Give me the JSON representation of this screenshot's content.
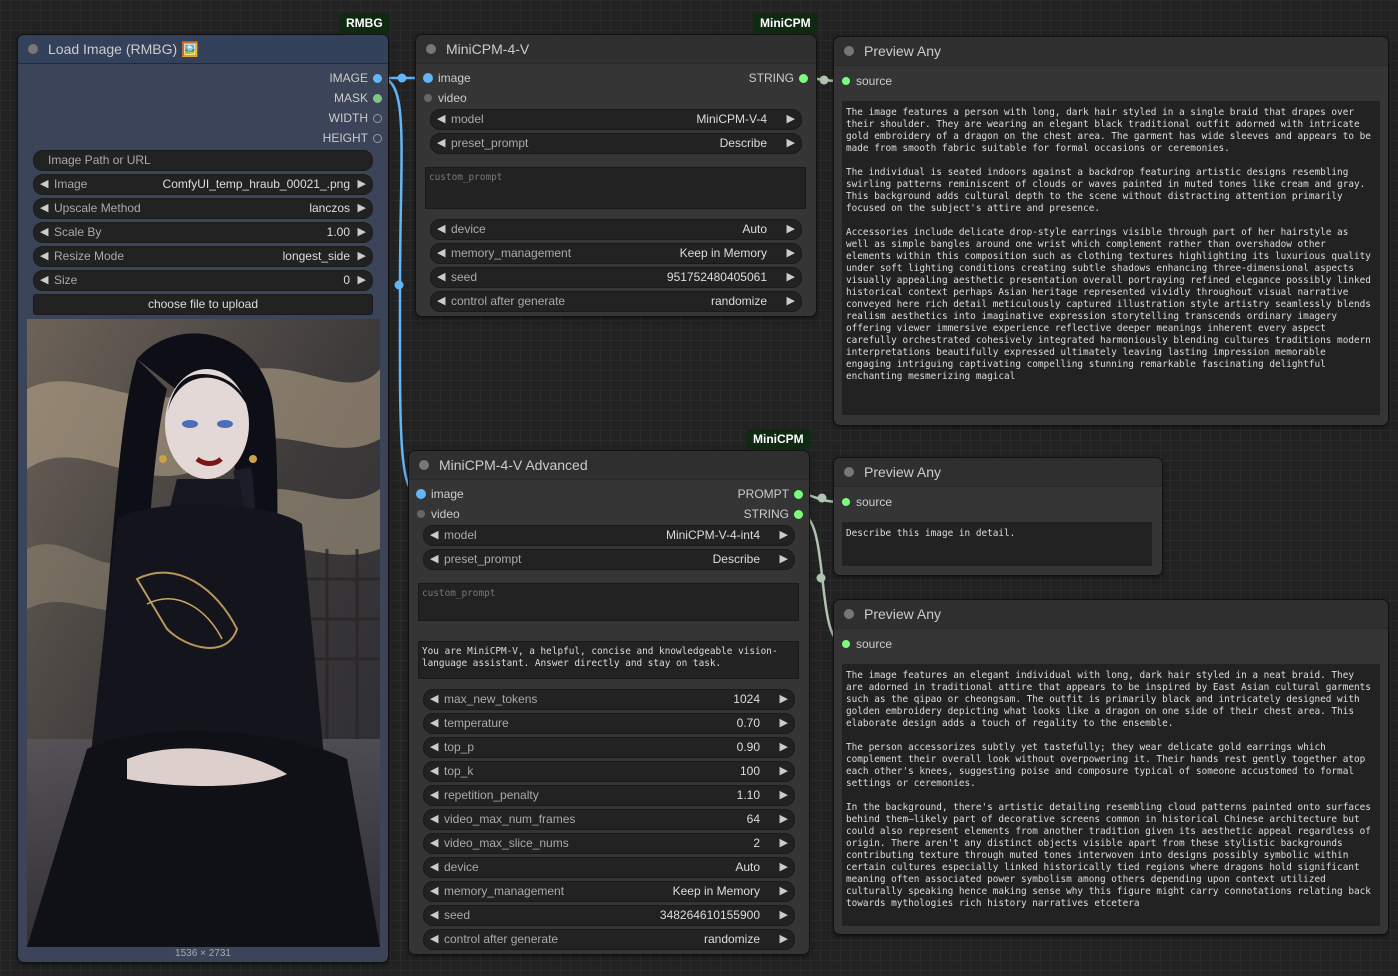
{
  "badges": {
    "rmbg": "RMBG",
    "minicpm1": "MiniCPM",
    "minicpm2": "MiniCPM"
  },
  "load_image": {
    "title": "Load Image (RMBG) 🖼️",
    "outputs": [
      "IMAGE",
      "MASK",
      "WIDTH",
      "HEIGHT"
    ],
    "path_label": "Image Path or URL",
    "widgets": [
      {
        "label": "Image",
        "value": "ComfyUI_temp_hraub_00021_.png"
      },
      {
        "label": "Upscale Method",
        "value": "lanczos"
      },
      {
        "label": "Scale By",
        "value": "1.00"
      },
      {
        "label": "Resize Mode",
        "value": "longest_side"
      },
      {
        "label": "Size",
        "value": "0"
      }
    ],
    "upload_button": "choose file to upload",
    "dimensions": "1536 × 2731"
  },
  "minicpm": {
    "title": "MiniCPM-4-V",
    "inputs": [
      "image",
      "video"
    ],
    "output": "STRING",
    "widgets_top": [
      {
        "label": "model",
        "value": "MiniCPM-V-4"
      },
      {
        "label": "preset_prompt",
        "value": "Describe"
      }
    ],
    "custom_prompt_placeholder": "custom_prompt",
    "widgets_bottom": [
      {
        "label": "device",
        "value": "Auto"
      },
      {
        "label": "memory_management",
        "value": "Keep in Memory"
      },
      {
        "label": "seed",
        "value": "951752480405061"
      },
      {
        "label": "control after generate",
        "value": "randomize"
      }
    ]
  },
  "minicpm_adv": {
    "title": "MiniCPM-4-V Advanced",
    "inputs": [
      "image",
      "video"
    ],
    "outputs": [
      "PROMPT",
      "STRING"
    ],
    "widgets_top": [
      {
        "label": "model",
        "value": "MiniCPM-V-4-int4"
      },
      {
        "label": "preset_prompt",
        "value": "Describe"
      }
    ],
    "custom_prompt_placeholder": "custom_prompt",
    "system_prompt": "You are MiniCPM-V, a helpful, concise and knowledgeable vision-language assistant. Answer directly and stay on task.",
    "widgets_bottom": [
      {
        "label": "max_new_tokens",
        "value": "1024"
      },
      {
        "label": "temperature",
        "value": "0.70"
      },
      {
        "label": "top_p",
        "value": "0.90"
      },
      {
        "label": "top_k",
        "value": "100"
      },
      {
        "label": "repetition_penalty",
        "value": "1.10"
      },
      {
        "label": "video_max_num_frames",
        "value": "64"
      },
      {
        "label": "video_max_slice_nums",
        "value": "2"
      },
      {
        "label": "device",
        "value": "Auto"
      },
      {
        "label": "memory_management",
        "value": "Keep in Memory"
      },
      {
        "label": "seed",
        "value": "348264610155900"
      },
      {
        "label": "control after generate",
        "value": "randomize"
      }
    ]
  },
  "preview1": {
    "title": "Preview Any",
    "input": "source",
    "text": "The image features a person with long, dark hair styled in a single braid that drapes over their shoulder. They are wearing an elegant black traditional outfit adorned with intricate gold embroidery of a dragon on the chest area. The garment has wide sleeves and appears to be made from smooth fabric suitable for formal occasions or ceremonies.\n\nThe individual is seated indoors against a backdrop featuring artistic designs resembling swirling patterns reminiscent of clouds or waves painted in muted tones like cream and gray. This background adds cultural depth to the scene without distracting attention primarily focused on the subject's attire and presence.\n\nAccessories include delicate drop-style earrings visible through part of her hairstyle as well as simple bangles around one wrist which complement rather than overshadow other elements within this composition such as clothing textures highlighting its luxurious quality under soft lighting conditions creating subtle shadows enhancing three-dimensional aspects visually appealing aesthetic presentation overall portraying refined elegance possibly linked historical context perhaps Asian heritage represented vividly throughout visual narrative conveyed here rich detail meticulously captured illustration style artistry seamlessly blends realism aesthetics into imaginative expression storytelling transcends ordinary imagery offering viewer immersive experience reflective deeper meanings inherent every aspect carefully orchestrated cohesively integrated harmoniously blending cultures traditions modern interpretations beautifully expressed ultimately leaving lasting impression memorable engaging intriguing captivating compelling stunning remarkable fascinating delightful enchanting mesmerizing magical"
  },
  "preview2": {
    "title": "Preview Any",
    "input": "source",
    "text": "Describe this image in detail."
  },
  "preview3": {
    "title": "Preview Any",
    "input": "source",
    "text": "The image features an elegant individual with long, dark hair styled in a neat braid. They are adorned in traditional attire that appears to be inspired by East Asian cultural garments such as the qipao or cheongsam. The outfit is primarily black and intricately designed with golden embroidery depicting what looks like a dragon on one side of their chest area. This elaborate design adds a touch of regality to the ensemble.\n\nThe person accessorizes subtly yet tastefully; they wear delicate gold earrings which complement their overall look without overpowering it. Their hands rest gently together atop each other's knees, suggesting poise and composure typical of someone accustomed to formal settings or ceremonies.\n\nIn the background, there's artistic detailing resembling cloud patterns painted onto surfaces behind them—likely part of decorative screens common in historical Chinese architecture but could also represent elements from another tradition given its aesthetic appeal regardless of origin. There aren't any distinct objects visible apart from these stylistic backgrounds contributing texture through muted tones interwoven into designs possibly symbolic within certain cultures especially linked historically tied regions where dragons hold significant meaning often associated power symbolism among others depending upon context utilized culturally speaking hence making sense why this figure might carry connotations relating back towards mythologies rich history narratives etcetera"
  },
  "colors": {
    "image_slot": "#64b5f6",
    "mask_slot": "#81c784",
    "string_slot": "#7cfc7c",
    "wire_image": "#64b5f6",
    "wire_string": "#b0c4b0"
  }
}
